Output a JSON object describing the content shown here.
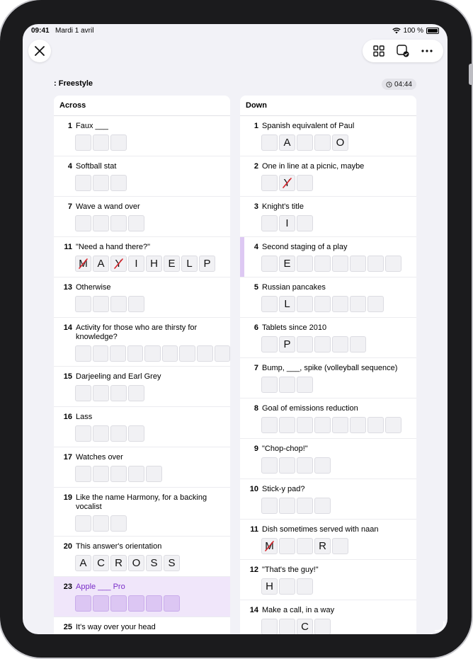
{
  "status": {
    "time": "09:41",
    "date": "Mardi 1 avril",
    "battery": "100 %"
  },
  "header": {
    "title": ": Freestyle",
    "timer": "04:44"
  },
  "icons": {
    "close": "close-icon",
    "grid": "grid-icon",
    "check": "check-square-icon",
    "more": "more-icon",
    "clock": "clock-icon"
  },
  "colors": {
    "accent": "#7b2fc9",
    "selected_row": "#f0e6fa",
    "selected_cell": "#dcc6f3",
    "error": "#d8232a"
  },
  "across": {
    "heading": "Across",
    "clues": [
      {
        "num": "1",
        "text": "Faux ___",
        "cells": [
          "",
          "",
          ""
        ],
        "wrong": [],
        "selected": false
      },
      {
        "num": "4",
        "text": "Softball stat",
        "cells": [
          "",
          "",
          ""
        ],
        "wrong": [],
        "selected": false
      },
      {
        "num": "7",
        "text": "Wave a wand over",
        "cells": [
          "",
          "",
          "",
          ""
        ],
        "wrong": [],
        "selected": false
      },
      {
        "num": "11",
        "text": "\"Need a hand there?\"",
        "cells": [
          "M",
          "A",
          "Y",
          "I",
          "H",
          "E",
          "L",
          "P"
        ],
        "wrong": [
          0,
          2
        ],
        "selected": false
      },
      {
        "num": "13",
        "text": "Otherwise",
        "cells": [
          "",
          "",
          "",
          ""
        ],
        "wrong": [],
        "selected": false
      },
      {
        "num": "14",
        "text": "Activity for those who are thirsty for knowledge?",
        "cells": [
          "",
          "",
          "",
          "",
          "",
          "",
          "",
          "",
          ""
        ],
        "wrong": [],
        "selected": false
      },
      {
        "num": "15",
        "text": "Darjeeling and Earl Grey",
        "cells": [
          "",
          "",
          "",
          ""
        ],
        "wrong": [],
        "selected": false
      },
      {
        "num": "16",
        "text": "Lass",
        "cells": [
          "",
          "",
          "",
          ""
        ],
        "wrong": [],
        "selected": false
      },
      {
        "num": "17",
        "text": "Watches over",
        "cells": [
          "",
          "",
          "",
          "",
          ""
        ],
        "wrong": [],
        "selected": false
      },
      {
        "num": "19",
        "text": "Like the name Harmony, for a backing vocalist",
        "cells": [
          "",
          "",
          ""
        ],
        "wrong": [],
        "selected": false
      },
      {
        "num": "20",
        "text": "This answer's orientation",
        "cells": [
          "A",
          "C",
          "R",
          "O",
          "S",
          "S"
        ],
        "wrong": [],
        "selected": false
      },
      {
        "num": "23",
        "text": "Apple ___ Pro",
        "cells": [
          "",
          "",
          "",
          "",
          "",
          ""
        ],
        "wrong": [],
        "selected": true
      },
      {
        "num": "25",
        "text": "It's way over your head",
        "cells": [],
        "wrong": [],
        "selected": false
      }
    ]
  },
  "down": {
    "heading": "Down",
    "clues": [
      {
        "num": "1",
        "text": "Spanish equivalent of Paul",
        "cells": [
          "",
          "A",
          "",
          "",
          "O"
        ],
        "wrong": [],
        "bar": false
      },
      {
        "num": "2",
        "text": "One in line at a picnic, maybe",
        "cells": [
          "",
          "Y",
          ""
        ],
        "wrong": [
          1
        ],
        "bar": false
      },
      {
        "num": "3",
        "text": "Knight's title",
        "cells": [
          "",
          "I",
          ""
        ],
        "wrong": [],
        "bar": false
      },
      {
        "num": "4",
        "text": "Second staging of a play",
        "cells": [
          "",
          "E",
          "",
          "",
          "",
          "",
          "",
          ""
        ],
        "wrong": [],
        "bar": true
      },
      {
        "num": "5",
        "text": "Russian pancakes",
        "cells": [
          "",
          "L",
          "",
          "",
          "",
          "",
          ""
        ],
        "wrong": [],
        "bar": false
      },
      {
        "num": "6",
        "text": "Tablets since 2010",
        "cells": [
          "",
          "P",
          "",
          "",
          "",
          ""
        ],
        "wrong": [],
        "bar": false
      },
      {
        "num": "7",
        "text": "Bump, ___, spike (volleyball sequence)",
        "cells": [
          "",
          "",
          ""
        ],
        "wrong": [],
        "bar": false
      },
      {
        "num": "8",
        "text": "Goal of emissions reduction",
        "cells": [
          "",
          "",
          "",
          "",
          "",
          "",
          "",
          ""
        ],
        "wrong": [],
        "bar": false
      },
      {
        "num": "9",
        "text": "\"Chop-chop!\"",
        "cells": [
          "",
          "",
          "",
          ""
        ],
        "wrong": [],
        "bar": false
      },
      {
        "num": "10",
        "text": "Stick-y pad?",
        "cells": [
          "",
          "",
          "",
          ""
        ],
        "wrong": [],
        "bar": false
      },
      {
        "num": "11",
        "text": "Dish sometimes served with naan",
        "cells": [
          "M",
          "",
          "",
          "R",
          ""
        ],
        "wrong": [
          0
        ],
        "bar": false
      },
      {
        "num": "12",
        "text": "\"That's the guy!\"",
        "cells": [
          "H",
          "",
          ""
        ],
        "wrong": [],
        "bar": false
      },
      {
        "num": "14",
        "text": "Make a call, in a way",
        "cells": [
          "",
          "",
          "C",
          ""
        ],
        "wrong": [],
        "bar": false
      }
    ]
  }
}
